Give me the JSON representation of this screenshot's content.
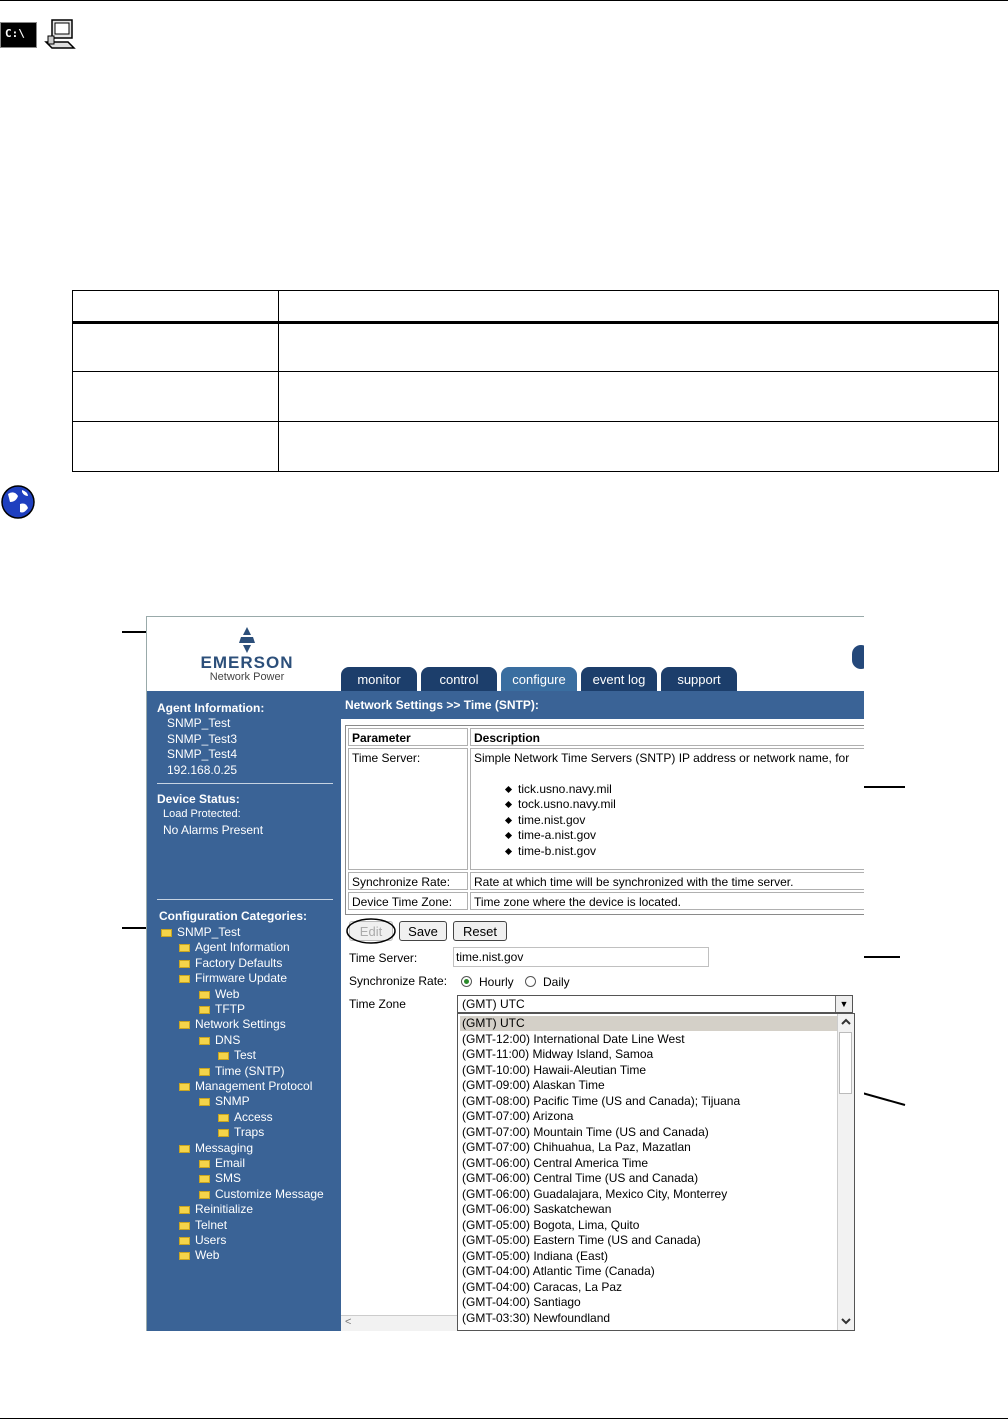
{
  "header_icons": {
    "cmd_icon": "C:\\",
    "computer_icon": "computer-icon",
    "globe_icon": "globe-icon"
  },
  "app": {
    "logo_text": "EMERSON",
    "logo_sub": "Network Power",
    "tabs": [
      "monitor",
      "control",
      "configure",
      "event log",
      "support"
    ],
    "active_tab": "configure",
    "breadcrumb": "Network Settings >> Time (SNTP):"
  },
  "sidebar": {
    "agent_title": "Agent Information:",
    "agent_items": [
      "SNMP_Test",
      "SNMP_Test3",
      "SNMP_Test4",
      "192.168.0.25"
    ],
    "device_title": "Device Status:",
    "device_items": [
      "Load Protected:",
      "No Alarms Present"
    ],
    "config_title": "Configuration Categories:",
    "tree": [
      {
        "label": "SNMP_Test",
        "level": 0
      },
      {
        "label": "Agent Information",
        "level": 1
      },
      {
        "label": "Factory Defaults",
        "level": 1
      },
      {
        "label": "Firmware Update",
        "level": 1
      },
      {
        "label": "Web",
        "level": 2
      },
      {
        "label": "TFTP",
        "level": 2
      },
      {
        "label": "Network Settings",
        "level": 1
      },
      {
        "label": "DNS",
        "level": 2
      },
      {
        "label": "Test",
        "level": 3
      },
      {
        "label": "Time (SNTP)",
        "level": 2
      },
      {
        "label": "Management Protocol",
        "level": 1
      },
      {
        "label": "SNMP",
        "level": 2
      },
      {
        "label": "Access",
        "level": 3
      },
      {
        "label": "Traps",
        "level": 3
      },
      {
        "label": "Messaging",
        "level": 1
      },
      {
        "label": "Email",
        "level": 2
      },
      {
        "label": "SMS",
        "level": 2
      },
      {
        "label": "Customize Message",
        "level": 2
      },
      {
        "label": "Reinitialize",
        "level": 1
      },
      {
        "label": "Telnet",
        "level": 1
      },
      {
        "label": "Users",
        "level": 1
      },
      {
        "label": "Web",
        "level": 1
      }
    ]
  },
  "params_table": {
    "headers": [
      "Parameter",
      "Description"
    ],
    "rows": [
      {
        "param": "Time Server:",
        "desc": "Simple Network Time Servers (SNTP) IP address or network name, for"
      },
      {
        "param": "Synchronize Rate:",
        "desc": "Rate at which time will be synchronized with the time server."
      },
      {
        "param": "Device Time Zone:",
        "desc": "Time zone where the device is located."
      }
    ],
    "servers": [
      "tick.usno.navy.mil",
      "tock.usno.navy.mil",
      "time.nist.gov",
      "time-a.nist.gov",
      "time-b.nist.gov"
    ]
  },
  "buttons": {
    "edit": "Edit",
    "save": "Save",
    "reset": "Reset"
  },
  "form": {
    "time_server_label": "Time Server:",
    "time_server_value": "time.nist.gov",
    "sync_label": "Synchronize Rate:",
    "sync_options": [
      "Hourly",
      "Daily"
    ],
    "sync_selected": "Hourly",
    "tz_label": "Time Zone",
    "tz_selected": "(GMT) UTC",
    "tz_options": [
      "(GMT) UTC",
      "(GMT-12:00) International Date Line West",
      "(GMT-11:00) Midway Island, Samoa",
      "(GMT-10:00) Hawaii-Aleutian Time",
      "(GMT-09:00) Alaskan Time",
      "(GMT-08:00) Pacific Time (US and Canada); Tijuana",
      "(GMT-07:00) Arizona",
      "(GMT-07:00) Mountain Time (US and Canada)",
      "(GMT-07:00) Chihuahua, La Paz, Mazatlan",
      "(GMT-06:00) Central America Time",
      "(GMT-06:00) Central Time (US and Canada)",
      "(GMT-06:00) Guadalajara, Mexico City, Monterrey",
      "(GMT-06:00) Saskatchewan",
      "(GMT-05:00) Bogota, Lima, Quito",
      "(GMT-05:00) Eastern Time (US and Canada)",
      "(GMT-05:00) Indiana (East)",
      "(GMT-04:00) Atlantic Time (Canada)",
      "(GMT-04:00) Caracas, La Paz",
      "(GMT-04:00) Santiago",
      "(GMT-03:30) Newfoundland"
    ]
  }
}
